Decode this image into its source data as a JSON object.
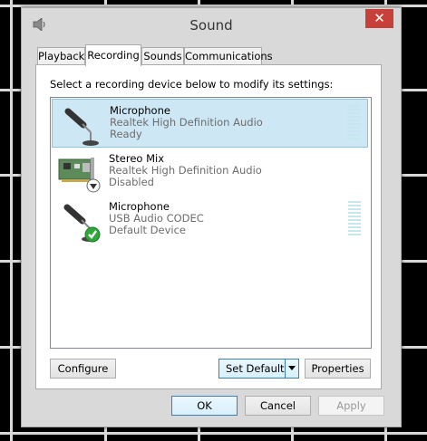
{
  "window": {
    "title": "Sound",
    "close_label": "✕"
  },
  "tabs": [
    {
      "label": "Playback"
    },
    {
      "label": "Recording"
    },
    {
      "label": "Sounds"
    },
    {
      "label": "Communications"
    }
  ],
  "panel": {
    "instruction": "Select a recording device below to modify its settings:",
    "devices": [
      {
        "name": "Microphone",
        "driver": "Realtek High Definition Audio",
        "status": "Ready",
        "icon": "microphone-icon",
        "selected": true
      },
      {
        "name": "Stereo Mix",
        "driver": "Realtek High Definition Audio",
        "status": "Disabled",
        "icon": "sound-card-icon",
        "badge": "disabled-arrow-icon"
      },
      {
        "name": "Microphone",
        "driver": "USB Audio CODEC",
        "status": "Default Device",
        "icon": "microphone-icon",
        "badge": "default-check-icon"
      }
    ]
  },
  "buttons": {
    "configure": "Configure",
    "set_default": "Set Default",
    "properties": "Properties",
    "ok": "OK",
    "cancel": "Cancel",
    "apply": "Apply"
  },
  "colors": {
    "selection": "#cde8f4",
    "close": "#c7413a",
    "default_badge": "#2fa63a"
  }
}
